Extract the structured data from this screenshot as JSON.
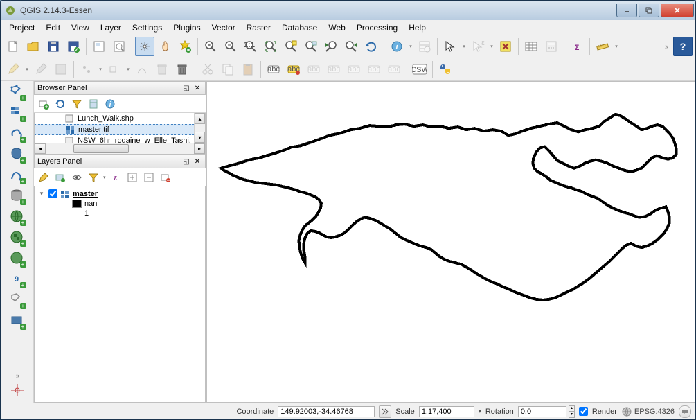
{
  "window": {
    "title": "QGIS 2.14.3-Essen"
  },
  "menu": [
    "Project",
    "Edit",
    "View",
    "Layer",
    "Settings",
    "Plugins",
    "Vector",
    "Raster",
    "Database",
    "Web",
    "Processing",
    "Help"
  ],
  "browser_panel": {
    "title": "Browser Panel",
    "items": [
      "Lunch_Walk.shp",
      "master.tif",
      "NSW_6hr_rogaine_w_Elle_Tashi."
    ]
  },
  "layers_panel": {
    "title": "Layers Panel",
    "layer_name": "master",
    "legend_label_1": "nan",
    "legend_label_2": "1"
  },
  "status": {
    "coord_label": "Coordinate",
    "coord_value": "149.92003,-34.46768",
    "scale_label": "Scale",
    "scale_value": "1:17,400",
    "rotation_label": "Rotation",
    "rotation_value": "0.0",
    "render_label": "Render",
    "crs": "EPSG:4326"
  }
}
